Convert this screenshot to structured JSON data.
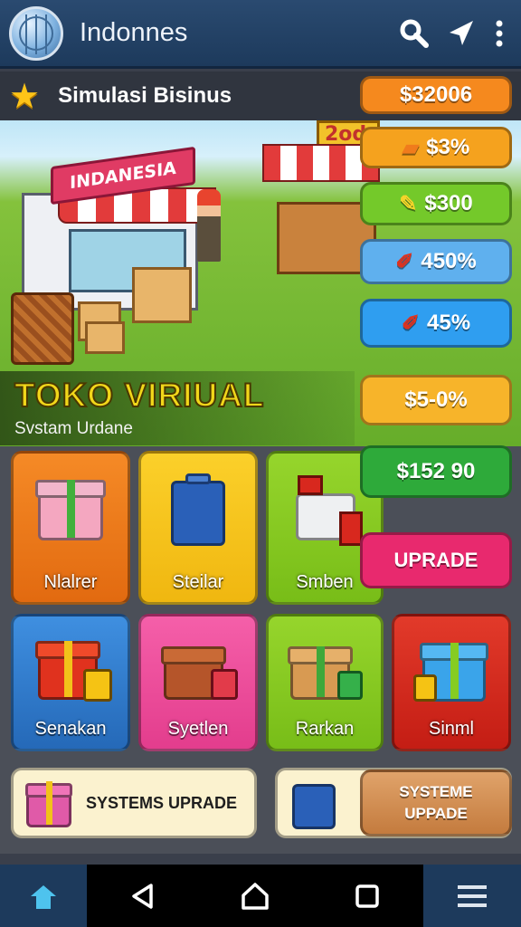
{
  "appbar": {
    "title": "Indonnes",
    "icons": [
      "globe-icon",
      "search-icon",
      "location-arrow-icon",
      "more-vert-icon"
    ]
  },
  "strip": {
    "title": "Simulasi Bisinus",
    "icon": "star-icon"
  },
  "scene": {
    "shop_sign": "INDANESIA",
    "stall_sign": "2od",
    "game_title": "TOKO VIRIUAL",
    "game_subtitle": "Svstam Urdane"
  },
  "prices": [
    {
      "label": "$32006",
      "icon": "",
      "color": "#f5891e"
    },
    {
      "label": "$3%",
      "icon": "wallet-icon",
      "color": "#f5a21e"
    },
    {
      "label": "$300",
      "icon": "pencil-icon",
      "color": "#74c92a"
    },
    {
      "label": "450%",
      "icon": "marker-icon",
      "color": "#5fb0ee"
    },
    {
      "label": "45%",
      "icon": "marker-icon",
      "color": "#2f9ef0"
    },
    {
      "label": "$5-0%",
      "icon": "",
      "color": "#f7b42a"
    },
    {
      "label": "$152 90",
      "icon": "",
      "color": "#2eaa3a"
    },
    {
      "label": "UPRADE",
      "icon": "",
      "color": "#e8296e"
    }
  ],
  "cards_row1": [
    {
      "label": "Nlalrer",
      "color": "#f07b1c",
      "icon": "gift-box-icon"
    },
    {
      "label": "Steilar",
      "color": "#f5c314",
      "icon": "blue-case-icon"
    },
    {
      "label": "Smben",
      "color": "#86cc22",
      "icon": "register-icon"
    }
  ],
  "cards_row2": [
    {
      "label": "Senakan",
      "color": "#2f7fd0",
      "icon": "red-gift-icon"
    },
    {
      "label": "Syetlen",
      "color": "#ef4f9e",
      "icon": "brown-box-icon"
    },
    {
      "label": "Rarkan",
      "color": "#86cc22",
      "icon": "open-box-icon"
    },
    {
      "label": "Sinml",
      "color": "#d8281e",
      "icon": "blue-gift-icon"
    }
  ],
  "bottom": {
    "systems_upgrade": "SYSTEMS UPRADE",
    "systeme_upgrade": "SYSTEME\nUPPADE"
  },
  "nav": {
    "icons": [
      "home-icon",
      "back-icon",
      "home-outline-icon",
      "recents-icon",
      "menu-icon"
    ]
  }
}
